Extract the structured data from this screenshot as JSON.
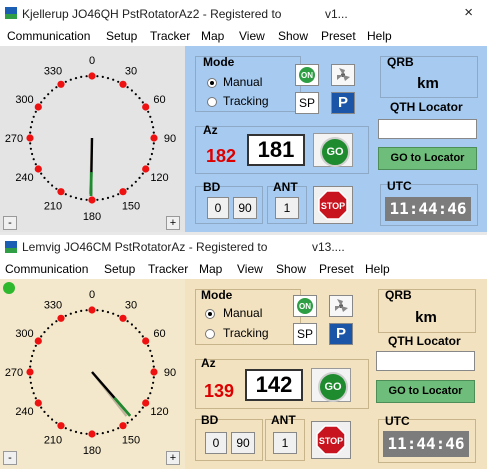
{
  "windows": [
    {
      "title": "Kjellerup JO46QH PstRotatorAz2 - Registered to",
      "title_suffix": "v1...",
      "close_glyph": "×",
      "menu": [
        "Communication",
        "Setup",
        "Tracker",
        "Map",
        "View",
        "Show",
        "Preset",
        "Help"
      ],
      "dial": {
        "labels": [
          "0",
          "30",
          "60",
          "90",
          "120",
          "150",
          "180",
          "210",
          "240",
          "270",
          "300",
          "330"
        ],
        "needle_az": 181,
        "target_az": 182,
        "status_led": false,
        "bg": "#e4e4e4"
      },
      "mode": {
        "label": "Mode",
        "manual": "Manual",
        "tracking": "Tracking",
        "selected": "manual"
      },
      "on_label": "ON",
      "sp_label": "SP",
      "park_label": "P",
      "az": {
        "label": "Az",
        "set": "182",
        "current": "181",
        "go_label": "GO"
      },
      "bd": {
        "label": "BD",
        "b0": "0",
        "b90": "90"
      },
      "ant": {
        "label": "ANT",
        "value": "1"
      },
      "stop_label": "STOP",
      "qrb": {
        "label": "QRB",
        "unit": "km"
      },
      "qth": {
        "label": "QTH Locator",
        "value": "",
        "go_label": "GO to Locator"
      },
      "utc": {
        "label": "UTC",
        "time": "11:44:46"
      },
      "minus": "-",
      "plus": "+",
      "bg_color": "#a6caf0"
    },
    {
      "title": "Lemvig JO46CM PstRotatorAz - Registered to",
      "title_suffix": "v13....",
      "close_glyph": "",
      "menu": [
        "Communication",
        "Setup",
        "Tracker",
        "Map",
        "View",
        "Show",
        "Preset",
        "Help"
      ],
      "dial": {
        "labels": [
          "0",
          "30",
          "60",
          "90",
          "120",
          "150",
          "180",
          "210",
          "240",
          "270",
          "300",
          "330"
        ],
        "needle_az": 139,
        "target_az": 142,
        "status_led": true,
        "bg": "#f4e8cc"
      },
      "mode": {
        "label": "Mode",
        "manual": "Manual",
        "tracking": "Tracking",
        "selected": "manual"
      },
      "on_label": "ON",
      "sp_label": "SP",
      "park_label": "P",
      "az": {
        "label": "Az",
        "set": "139",
        "current": "142",
        "go_label": "GO"
      },
      "bd": {
        "label": "BD",
        "b0": "0",
        "b90": "90"
      },
      "ant": {
        "label": "ANT",
        "value": "1"
      },
      "stop_label": "STOP",
      "qrb": {
        "label": "QRB",
        "unit": "km"
      },
      "qth": {
        "label": "QTH Locator",
        "value": "",
        "go_label": "GO to Locator"
      },
      "utc": {
        "label": "UTC",
        "time": "11:44:46"
      },
      "minus": "-",
      "plus": "+",
      "bg_color": "#f2e2c0"
    }
  ],
  "icons": {
    "app": "app-icon",
    "on": "power-on-icon",
    "fan": "fan-icon",
    "park": "parking-icon",
    "go": "go-icon",
    "stop": "stop-sign-icon"
  },
  "colors": {
    "set_az": "#dd0000",
    "go_green": "#1d8b2e",
    "led_green": "#2db82d",
    "utc_bg": "#7c7c7c",
    "stop_red": "#c8141e",
    "dot_red": "#ee1111"
  }
}
